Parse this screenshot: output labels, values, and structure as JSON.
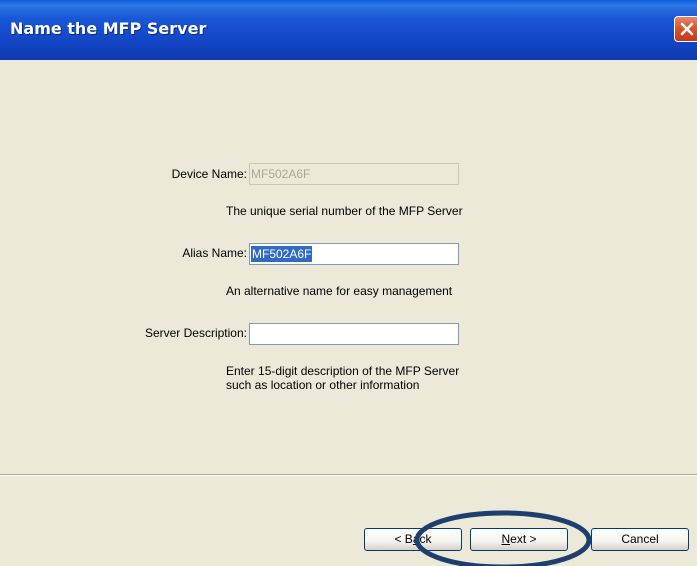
{
  "window": {
    "title": "Name the MFP Server"
  },
  "form": {
    "device_name_label": "Device Name:",
    "device_name_value": "MF502A6F",
    "device_name_hint": "The unique serial number of the MFP Server",
    "alias_name_label": "Alias Name:",
    "alias_name_value": "MF502A6F",
    "alias_name_hint": "An alternative name for easy management",
    "server_description_label": "Server Description:",
    "server_description_value": "",
    "server_description_hint_line1": "Enter 15-digit description of the MFP Server",
    "server_description_hint_line2": "such as location or other information"
  },
  "buttons": {
    "back_prefix": "< B",
    "back_accel": "a",
    "back_suffix": "ck",
    "next_accel": "N",
    "next_suffix": "ext >",
    "cancel_label": "Cancel"
  },
  "annotation": {
    "highlight_color": "#1C3F6E"
  },
  "colors": {
    "titlebar": "#1245C4",
    "dialog_background": "#ECE9D8",
    "selection": "#316AC5"
  }
}
